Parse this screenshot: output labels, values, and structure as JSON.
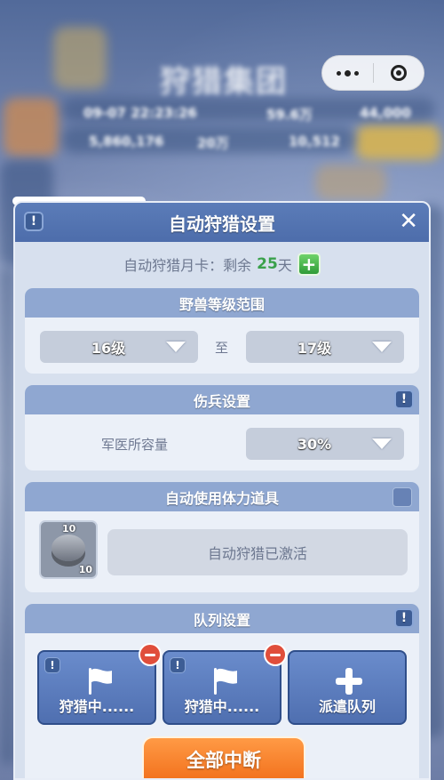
{
  "background": {
    "title_blurred": "狩猎集团",
    "row1": "09-07 22:23:26",
    "row1b": "59.6万",
    "row1c": "44,000",
    "row2": "5,860,176",
    "row2b": "20万",
    "row2c": "10,512"
  },
  "capsule": {
    "more": "more-dots-icon",
    "close": "target-icon"
  },
  "dialog": {
    "title": "自动狩猎设置",
    "info_icon": "!",
    "close_icon": "✕",
    "month_card": {
      "prefix": "自动狩猎月卡：剩余",
      "days": "25",
      "suffix": "天"
    },
    "beast_range": {
      "title": "野兽等级范围",
      "from": "16级",
      "connector": "至",
      "to": "17级"
    },
    "wounded": {
      "title": "伤兵设置",
      "label": "军医所容量",
      "value": "30%"
    },
    "stamina": {
      "title": "自动使用体力道具",
      "item_top_qty": "10",
      "item_bottom_qty": "10",
      "status": "自动狩猎已激活"
    },
    "queue": {
      "title": "队列设置",
      "cards": [
        {
          "label": "狩猎中......"
        },
        {
          "label": "狩猎中......"
        },
        {
          "label": "派遣队列"
        }
      ]
    },
    "stop_all": "全部中断"
  },
  "colors": {
    "header": "#4d6dab",
    "section_head": "#8fa7d1",
    "accent_green": "#3aa14b",
    "stop_button": "#f06a16",
    "remove": "#e04e3b"
  }
}
